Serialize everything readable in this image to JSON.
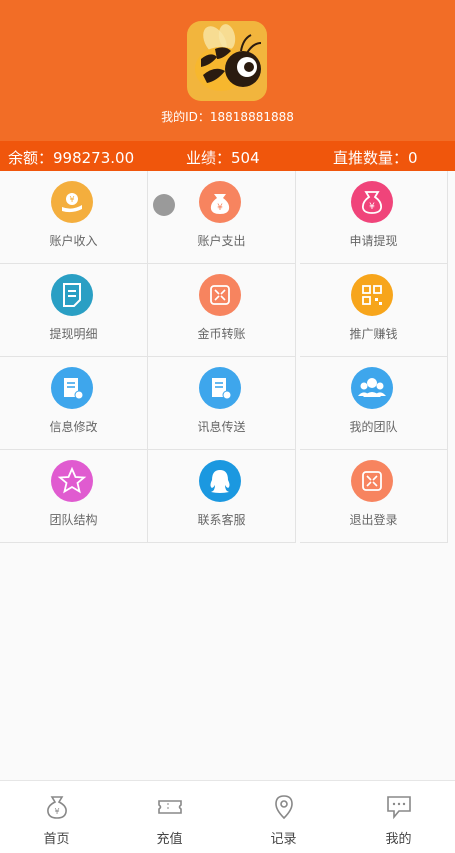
{
  "profile": {
    "id_label": "我的ID：18818881888"
  },
  "stats": {
    "balance": "余额：998273.00",
    "performance": "业绩：504",
    "referrals": "直推数量：0"
  },
  "menu": [
    {
      "label": "账户收入",
      "icon": "income-icon",
      "color": "#f4ae3d"
    },
    {
      "label": "账户支出",
      "icon": "money-bag-icon",
      "color": "#f7845f"
    },
    {
      "label": "申请提现",
      "icon": "withdraw-bag-icon",
      "color": "#f0447a"
    },
    {
      "label": "提现明细",
      "icon": "document-icon",
      "color": "#2a9fc4"
    },
    {
      "label": "金币转账",
      "icon": "transfer-icon",
      "color": "#f7845f"
    },
    {
      "label": "推广赚钱",
      "icon": "qrcode-icon",
      "color": "#f7a51b"
    },
    {
      "label": "信息修改",
      "icon": "edit-info-icon",
      "color": "#3ea6ec"
    },
    {
      "label": "讯息传送",
      "icon": "message-send-icon",
      "color": "#3ea6ec"
    },
    {
      "label": "我的团队",
      "icon": "team-icon",
      "color": "#3ea6ec"
    },
    {
      "label": "团队结构",
      "icon": "star-icon",
      "color": "#e05bd0"
    },
    {
      "label": "联系客服",
      "icon": "qq-icon",
      "color": "#1b98e0"
    },
    {
      "label": "退出登录",
      "icon": "logout-icon",
      "color": "#f7845f"
    }
  ],
  "tabbar": [
    {
      "label": "首页",
      "icon": "money-bag-icon"
    },
    {
      "label": "充值",
      "icon": "ticket-icon"
    },
    {
      "label": "记录",
      "icon": "location-pin-icon"
    },
    {
      "label": "我的",
      "icon": "chat-icon"
    }
  ]
}
